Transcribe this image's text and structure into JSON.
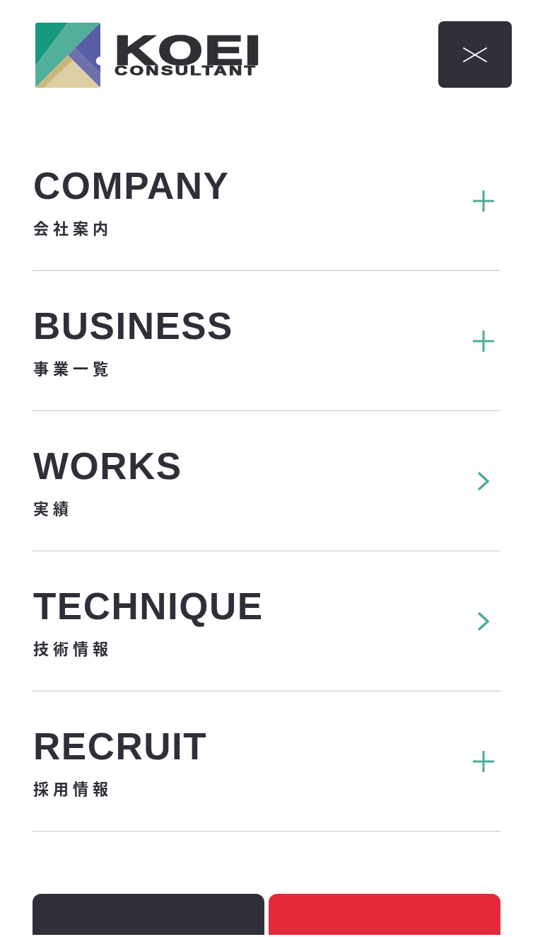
{
  "header": {
    "logo": {
      "name": "KOEI",
      "tagline": "CONSULTANT"
    }
  },
  "menu": [
    {
      "title": "COMPANY",
      "subtitle": "会社案内",
      "kind": "accordion"
    },
    {
      "title": "BUSINESS",
      "subtitle": "事業一覧",
      "kind": "accordion"
    },
    {
      "title": "WORKS",
      "subtitle": "実績",
      "kind": "link"
    },
    {
      "title": "TECHNIQUE",
      "subtitle": "技術情報",
      "kind": "link"
    },
    {
      "title": "RECRUIT",
      "subtitle": "採用情報",
      "kind": "accordion"
    }
  ],
  "footer_buttons": [
    {
      "color": "#30303a"
    },
    {
      "color": "#e4293b"
    }
  ]
}
